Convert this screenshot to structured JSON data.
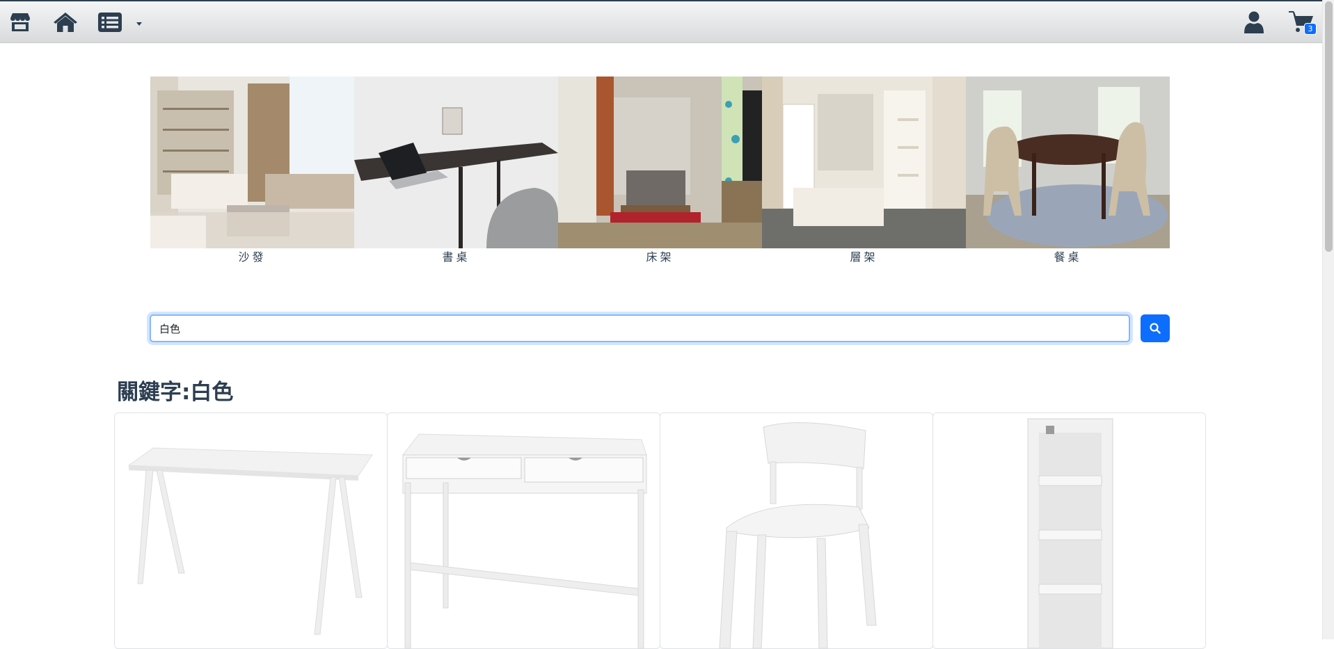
{
  "header": {
    "store_icon": "store-icon",
    "home_icon": "home-icon",
    "menu_icon": "list-icon",
    "user_icon": "user-icon",
    "cart_icon": "cart-icon",
    "cart_count": "3"
  },
  "categories": [
    {
      "label": "沙發",
      "icon": "sofa-photo"
    },
    {
      "label": "書桌",
      "icon": "desk-photo"
    },
    {
      "label": "床架",
      "icon": "bed-photo"
    },
    {
      "label": "層架",
      "icon": "shelf-photo"
    },
    {
      "label": "餐桌",
      "icon": "dining-table-photo"
    }
  ],
  "search": {
    "value": "白色",
    "button_icon": "search-icon"
  },
  "results": {
    "title": "關鍵字:白色",
    "products": [
      {
        "icon": "white-desk-photo"
      },
      {
        "icon": "white-desk-drawers-photo"
      },
      {
        "icon": "white-chair-photo"
      },
      {
        "icon": "white-shelf-photo"
      }
    ]
  },
  "colors": {
    "primary": "#0d6efd",
    "text": "#2c3e50",
    "focus_border": "#86b7fe"
  }
}
